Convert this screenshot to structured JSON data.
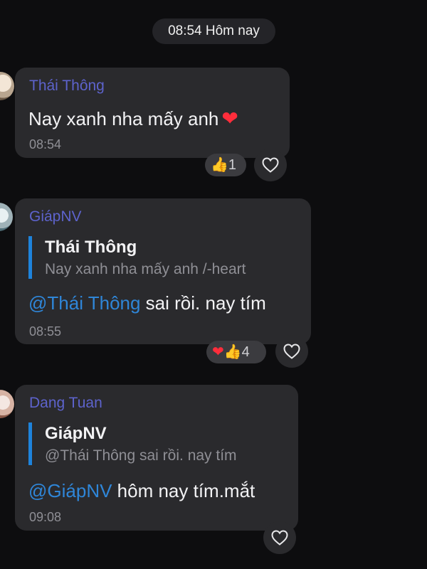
{
  "conversation": {
    "date_chip": "08:54 Hôm nay",
    "messages": [
      {
        "sender": "Thái Thông",
        "text": "Nay xanh nha mấy anh",
        "emoji": "❤",
        "time": "08:54",
        "reactions": {
          "emoji": "👍",
          "count": "1"
        }
      },
      {
        "sender": "GiápNV",
        "quote": {
          "name": "Thái Thông",
          "text": "Nay xanh nha mấy anh /-heart"
        },
        "mention": "@Thái Thông",
        "text": " sai rồi. nay tím",
        "time": "08:55",
        "reactions": {
          "emoji1": "❤",
          "emoji2": "👍",
          "count": "4"
        }
      },
      {
        "sender": "Dang Tuan",
        "quote": {
          "name": "GiápNV",
          "text": "@Thái Thông sai rồi. nay tím"
        },
        "mention": "@GiápNV",
        "text": " hôm nay tím.mắt",
        "time": "09:08"
      }
    ]
  },
  "icons": {
    "react_button": "heart-outline-icon",
    "avatar": "avatar"
  },
  "colors": {
    "background": "#0d0d0f",
    "bubble": "#2a2a2d",
    "sender_name": "#5d63cc",
    "mention": "#2f86d8",
    "quote_bar": "#1e83db",
    "timestamp": "#8f8f95"
  }
}
